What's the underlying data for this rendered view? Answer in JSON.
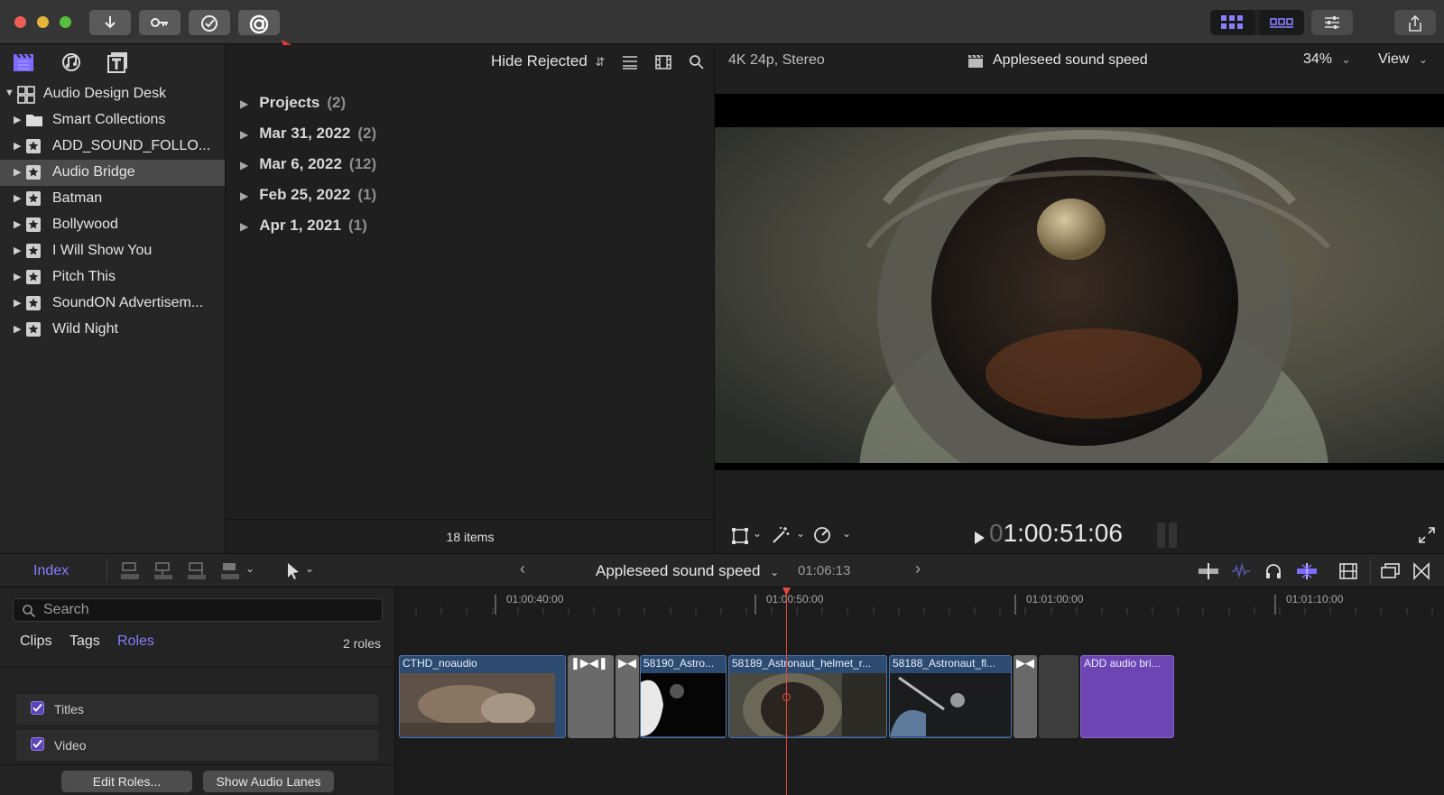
{
  "sidebar": {
    "items": [
      {
        "label": "Audio Design Desk",
        "expanded": true,
        "icon": "library-grid-icon"
      },
      {
        "label": "Smart Collections",
        "icon": "folder-icon"
      },
      {
        "label": "ADD_SOUND_FOLLO...",
        "icon": "event-star-icon"
      },
      {
        "label": "Audio Bridge",
        "icon": "event-star-icon",
        "selected": true
      },
      {
        "label": "Batman",
        "icon": "event-star-icon"
      },
      {
        "label": "Bollywood",
        "icon": "event-star-icon"
      },
      {
        "label": "I Will Show You",
        "icon": "event-star-icon"
      },
      {
        "label": "Pitch This",
        "icon": "event-star-icon"
      },
      {
        "label": "SoundON Advertisem...",
        "icon": "event-star-icon"
      },
      {
        "label": "Wild Night",
        "icon": "event-star-icon"
      }
    ]
  },
  "browser": {
    "filter": "Hide Rejected",
    "rows": [
      {
        "label": "Projects",
        "count": "(2)"
      },
      {
        "label": "Mar 31, 2022",
        "count": "(2)"
      },
      {
        "label": "Mar 6, 2022",
        "count": "(12)"
      },
      {
        "label": "Feb 25, 2022",
        "count": "(1)"
      },
      {
        "label": "Apr 1, 2021",
        "count": "(1)"
      }
    ],
    "footer": "18 items"
  },
  "viewer": {
    "format": "4K 24p, Stereo",
    "title": "Appleseed sound speed",
    "zoom": "34%",
    "view": "View",
    "timecode_dim": "0",
    "timecode": "1:00:51:06"
  },
  "timeline_toolbar": {
    "index": "Index",
    "project": "Appleseed sound speed",
    "duration": "01:06:13"
  },
  "index_panel": {
    "search_placeholder": "Search",
    "tabs": [
      "Clips",
      "Tags",
      "Roles"
    ],
    "active_tab": "Roles",
    "count": "2 roles",
    "roles": [
      "Titles",
      "Video"
    ],
    "edit_roles": "Edit Roles...",
    "show_audio_lanes": "Show Audio Lanes"
  },
  "timeline": {
    "ruler": [
      "01:00:40:00",
      "01:00:50:00",
      "01:01:00:00",
      "01:01:10:00"
    ],
    "clips": [
      "CTHD_noaudio",
      "58190_Astro...",
      "58189_Astronaut_helmet_r...",
      "58188_Astronaut_fl...",
      "ADD audio bri..."
    ]
  },
  "colors": {
    "accent": "#7d6cff",
    "playhead": "#e5483c",
    "audio_bridge_clip": "#6e46b4",
    "selection": "#4a4a4a"
  }
}
